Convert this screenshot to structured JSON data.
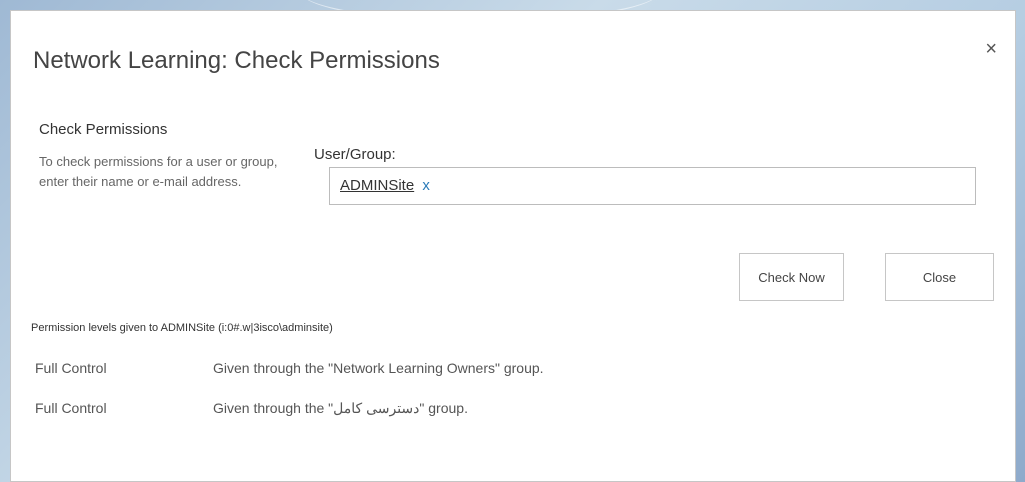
{
  "dialog": {
    "title": "Network Learning: Check Permissions",
    "close_glyph": "×",
    "close_icon": "close-icon"
  },
  "section": {
    "heading": "Check Permissions",
    "description": "To check permissions for a user or group, enter their name or e-mail address."
  },
  "user_group": {
    "label": "User/Group:",
    "resolved_name": "ADMINSite",
    "remove_glyph": "x"
  },
  "buttons": {
    "check_now": "Check Now",
    "close": "Close"
  },
  "results": {
    "caption": "Permission levels given to ADMINSite (i:0#.w|3isco\\adminsite)",
    "rows": [
      {
        "level": "Full Control",
        "source": "Given through the \"Network Learning Owners\" group."
      },
      {
        "level": "Full Control",
        "source": "Given through the \"دسترسی کامل\" group."
      }
    ]
  },
  "colors": {
    "link_accent": "#2a7ab8",
    "dialog_bg": "#ffffff",
    "border": "#c6c6c6"
  }
}
